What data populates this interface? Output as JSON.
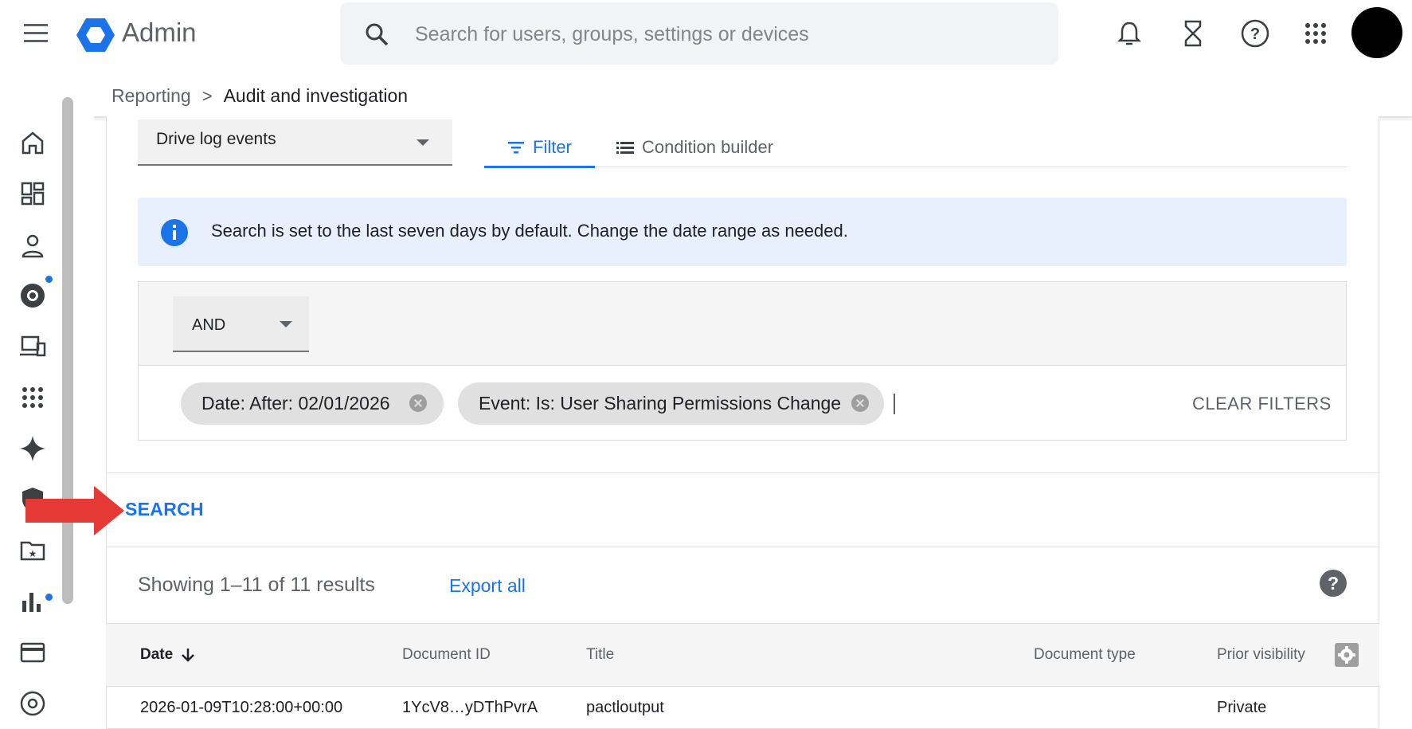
{
  "header": {
    "app_title": "Admin",
    "search_placeholder": "Search for users, groups, settings or devices"
  },
  "breadcrumb": {
    "parent": "Reporting",
    "separator": ">",
    "current": "Audit and investigation"
  },
  "data_source": {
    "selected": "Drive log events"
  },
  "tabs": [
    {
      "label": "Filter",
      "active": true
    },
    {
      "label": "Condition builder",
      "active": false
    }
  ],
  "info_banner": {
    "text": "Search is set to the last seven days by default. Change the date range as needed."
  },
  "filters": {
    "operator": "AND",
    "chips": [
      {
        "label": "Date: After: 02/01/2026"
      },
      {
        "label": "Event: Is: User Sharing Permissions Change"
      }
    ],
    "clear_label": "CLEAR FILTERS"
  },
  "search_button": "SEARCH",
  "results": {
    "summary": "Showing 1–11 of 11 results",
    "export_label": "Export all",
    "help": "?"
  },
  "table": {
    "columns": [
      "Date",
      "Document ID",
      "Title",
      "Document type",
      "Prior visibility"
    ],
    "rows": [
      [
        "2026-01-09T10:28:00+00:00",
        "1YcV8…yDThPvrA",
        "pactloutput",
        "",
        "Private"
      ]
    ]
  },
  "colors": {
    "accent": "#1a73e8",
    "banner_bg": "#e8f0fe",
    "annotation_arrow": "#e53935",
    "nav_dot": "#1a73e8"
  },
  "icons": {
    "nav": [
      "home-icon",
      "dashboard-icon",
      "person-icon",
      "chrome-icon",
      "devices-icon",
      "apps-icon",
      "sparkle-icon",
      "shield-icon",
      "folder-star-icon",
      "bar-chart-icon",
      "billing-card-icon",
      "account-icon"
    ]
  }
}
